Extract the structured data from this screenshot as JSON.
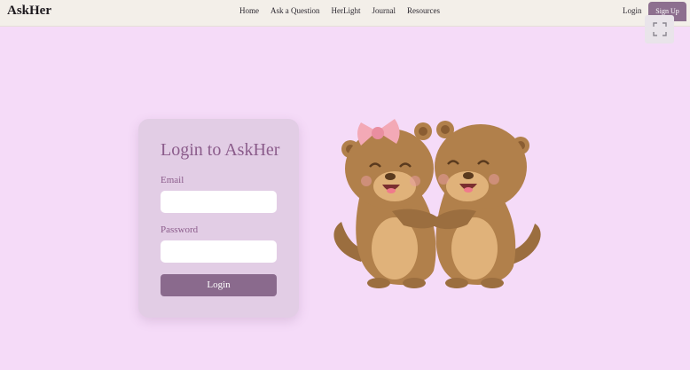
{
  "nav": {
    "brand": "AskHer",
    "links": [
      "Home",
      "Ask a Question",
      "HerLight",
      "Journal",
      "Resources"
    ],
    "login": "Login",
    "signup": "Sign Up"
  },
  "form": {
    "title": "Login to AskHer",
    "email_label": "Email",
    "password_label": "Password",
    "email_value": "",
    "password_value": "",
    "submit": "Login"
  },
  "icons": {
    "expand": "fullscreen-icon",
    "illustration": "two-otters-hugging-illustration"
  },
  "colors": {
    "page_bg": "#f5dbf8",
    "nav_bg": "#f3efe9",
    "card_bg": "#e2cde5",
    "accent": "#8a6a8d",
    "title_text": "#8b5c8b"
  }
}
